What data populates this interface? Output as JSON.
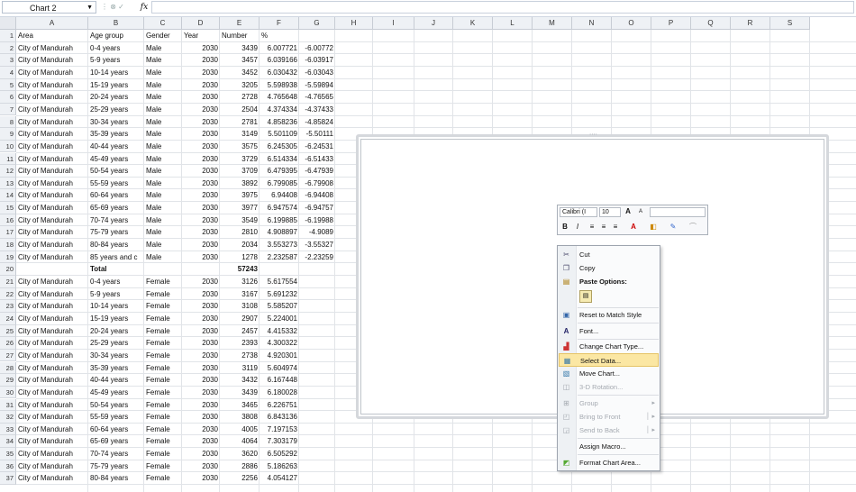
{
  "namebox": "Chart 2",
  "fx": "fx",
  "columns": [
    "A",
    "B",
    "C",
    "D",
    "E",
    "F",
    "G",
    "H",
    "I",
    "J",
    "K",
    "L",
    "M",
    "N",
    "O",
    "P",
    "Q",
    "R",
    "S"
  ],
  "rows": [
    [
      "Area",
      "Age group",
      "Gender",
      "Year",
      "Number",
      "%",
      ""
    ],
    [
      "City of Mandurah",
      "0-4 years",
      "Male",
      "2030",
      "3439",
      "6.007721",
      "-6.00772"
    ],
    [
      "City of Mandurah",
      "5-9 years",
      "Male",
      "2030",
      "3457",
      "6.039166",
      "-6.03917"
    ],
    [
      "City of Mandurah",
      "10-14 years",
      "Male",
      "2030",
      "3452",
      "6.030432",
      "-6.03043"
    ],
    [
      "City of Mandurah",
      "15-19 years",
      "Male",
      "2030",
      "3205",
      "5.598938",
      "-5.59894"
    ],
    [
      "City of Mandurah",
      "20-24 years",
      "Male",
      "2030",
      "2728",
      "4.765648",
      "-4.76565"
    ],
    [
      "City of Mandurah",
      "25-29 years",
      "Male",
      "2030",
      "2504",
      "4.374334",
      "-4.37433"
    ],
    [
      "City of Mandurah",
      "30-34 years",
      "Male",
      "2030",
      "2781",
      "4.858236",
      "-4.85824"
    ],
    [
      "City of Mandurah",
      "35-39 years",
      "Male",
      "2030",
      "3149",
      "5.501109",
      "-5.50111"
    ],
    [
      "City of Mandurah",
      "40-44 years",
      "Male",
      "2030",
      "3575",
      "6.245305",
      "-6.24531"
    ],
    [
      "City of Mandurah",
      "45-49 years",
      "Male",
      "2030",
      "3729",
      "6.514334",
      "-6.51433"
    ],
    [
      "City of Mandurah",
      "50-54 years",
      "Male",
      "2030",
      "3709",
      "6.479395",
      "-6.47939"
    ],
    [
      "City of Mandurah",
      "55-59 years",
      "Male",
      "2030",
      "3892",
      "6.799085",
      "-6.79908"
    ],
    [
      "City of Mandurah",
      "60-64 years",
      "Male",
      "2030",
      "3975",
      "6.94408",
      "-6.94408"
    ],
    [
      "City of Mandurah",
      "65-69 years",
      "Male",
      "2030",
      "3977",
      "6.947574",
      "-6.94757"
    ],
    [
      "City of Mandurah",
      "70-74 years",
      "Male",
      "2030",
      "3549",
      "6.199885",
      "-6.19988"
    ],
    [
      "City of Mandurah",
      "75-79 years",
      "Male",
      "2030",
      "2810",
      "4.908897",
      "-4.9089"
    ],
    [
      "City of Mandurah",
      "80-84 years",
      "Male",
      "2030",
      "2034",
      "3.553273",
      "-3.55327"
    ],
    [
      "City of Mandurah",
      "85 years and c",
      "Male",
      "2030",
      "1278",
      "2.232587",
      "-2.23259"
    ],
    [
      "",
      "Total",
      "",
      "",
      "57243",
      "",
      ""
    ],
    [
      "City of Mandurah",
      "0-4 years",
      "Female",
      "2030",
      "3126",
      "5.617554",
      ""
    ],
    [
      "City of Mandurah",
      "5-9 years",
      "Female",
      "2030",
      "3167",
      "5.691232",
      ""
    ],
    [
      "City of Mandurah",
      "10-14 years",
      "Female",
      "2030",
      "3108",
      "5.585207",
      ""
    ],
    [
      "City of Mandurah",
      "15-19 years",
      "Female",
      "2030",
      "2907",
      "5.224001",
      ""
    ],
    [
      "City of Mandurah",
      "20-24 years",
      "Female",
      "2030",
      "2457",
      "4.415332",
      ""
    ],
    [
      "City of Mandurah",
      "25-29 years",
      "Female",
      "2030",
      "2393",
      "4.300322",
      ""
    ],
    [
      "City of Mandurah",
      "30-34 years",
      "Female",
      "2030",
      "2738",
      "4.920301",
      ""
    ],
    [
      "City of Mandurah",
      "35-39 years",
      "Female",
      "2030",
      "3119",
      "5.604974",
      ""
    ],
    [
      "City of Mandurah",
      "40-44 years",
      "Female",
      "2030",
      "3432",
      "6.167448",
      ""
    ],
    [
      "City of Mandurah",
      "45-49 years",
      "Female",
      "2030",
      "3439",
      "6.180028",
      ""
    ],
    [
      "City of Mandurah",
      "50-54 years",
      "Female",
      "2030",
      "3465",
      "6.226751",
      ""
    ],
    [
      "City of Mandurah",
      "55-59 years",
      "Female",
      "2030",
      "3808",
      "6.843136",
      ""
    ],
    [
      "City of Mandurah",
      "60-64 years",
      "Female",
      "2030",
      "4005",
      "7.197153",
      ""
    ],
    [
      "City of Mandurah",
      "65-69 years",
      "Female",
      "2030",
      "4064",
      "7.303179",
      ""
    ],
    [
      "City of Mandurah",
      "70-74 years",
      "Female",
      "2030",
      "3620",
      "6.505292",
      ""
    ],
    [
      "City of Mandurah",
      "75-79 years",
      "Female",
      "2030",
      "2886",
      "5.186263",
      ""
    ],
    [
      "City of Mandurah",
      "80-84 years",
      "Female",
      "2030",
      "2256",
      "4.054127",
      ""
    ]
  ],
  "mini_toolbar": {
    "font": "Calibri (I",
    "size": "10",
    "grow": "A",
    "shrink": "A",
    "bold": "B",
    "italic": "I"
  },
  "context_menu": {
    "cut": "Cut",
    "copy": "Copy",
    "paste_options": "Paste Options:",
    "reset": "Reset to Match Style",
    "font": "Font...",
    "change_chart_type": "Change Chart Type...",
    "select_data": "Select Data...",
    "move_chart": "Move Chart...",
    "rotation": "3-D Rotation...",
    "group": "Group",
    "bring_to_front": "Bring to Front",
    "send_to_back": "Send to Back",
    "assign_macro": "Assign Macro...",
    "format_chart_area": "Format Chart Area..."
  },
  "colors": {
    "highlight": "#fbe7a3",
    "header_bg": "#eef1f5"
  }
}
